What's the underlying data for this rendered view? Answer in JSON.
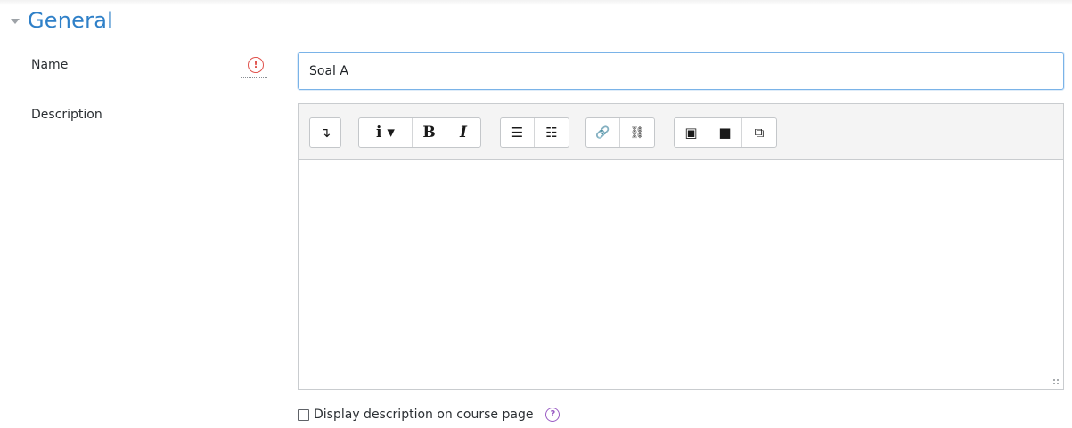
{
  "section": {
    "title": "General",
    "collapse_icon": "chevron-down-icon"
  },
  "name_field": {
    "label": "Name",
    "value": "Soal A",
    "required_icon": "exclamation-circle-icon",
    "required_glyph": "!"
  },
  "description_field": {
    "label": "Description",
    "toolbar": {
      "groups": [
        {
          "buttons": [
            {
              "icon": "show-more-buttons-icon",
              "glyph": "↴"
            }
          ]
        },
        {
          "buttons": [
            {
              "icon": "paragraph-styles-icon",
              "glyph": "i ▾"
            },
            {
              "icon": "bold-icon",
              "glyph": "B"
            },
            {
              "icon": "italic-icon",
              "glyph": "I"
            }
          ]
        },
        {
          "buttons": [
            {
              "icon": "unordered-list-icon",
              "glyph": "☰"
            },
            {
              "icon": "ordered-list-icon",
              "glyph": "☷"
            }
          ]
        },
        {
          "buttons": [
            {
              "icon": "link-icon",
              "glyph": "🔗"
            },
            {
              "icon": "unlink-icon",
              "glyph": "⛓"
            }
          ]
        },
        {
          "buttons": [
            {
              "icon": "image-icon",
              "glyph": "▣"
            },
            {
              "icon": "video-icon",
              "glyph": "■"
            },
            {
              "icon": "manage-files-icon",
              "glyph": "⧉"
            }
          ]
        }
      ]
    },
    "content": ""
  },
  "display_description": {
    "label": "Display description on course page",
    "checked": false,
    "help_icon": "question-circle-icon",
    "help_glyph": "?"
  },
  "colors": {
    "section_title": "#2f80c8",
    "required": "#e0524c",
    "help": "#9a5cc4",
    "input_focus_border": "#7ab3e8"
  }
}
